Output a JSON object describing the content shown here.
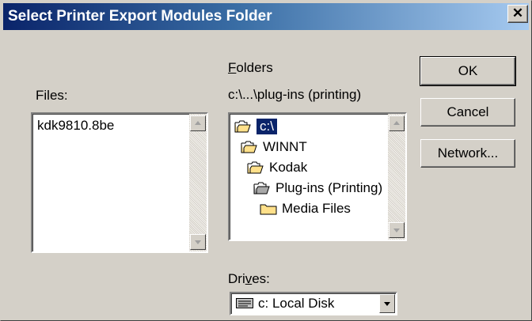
{
  "window": {
    "title": "Select Printer Export Modules Folder",
    "close_glyph": "✕"
  },
  "files": {
    "label": "Files:",
    "items": [
      "kdk9810.8be"
    ]
  },
  "folders": {
    "label_prefix": "",
    "label_accel": "F",
    "label_rest": "olders",
    "current_path": "c:\\...\\plug-ins (printing)",
    "items": [
      {
        "name": "c:\\",
        "selected": true,
        "icon": "open-folder-icon"
      },
      {
        "name": "WINNT",
        "icon": "open-folder-icon"
      },
      {
        "name": "Kodak",
        "icon": "open-folder-icon"
      },
      {
        "name": "Plug-ins (Printing)",
        "icon": "open-folder-icon"
      },
      {
        "name": "Media Files",
        "icon": "closed-folder-icon"
      }
    ]
  },
  "drives": {
    "label_prefix": "Dri",
    "label_accel": "v",
    "label_rest": "es:",
    "selected": "c: Local Disk",
    "icon": "drive-icon"
  },
  "buttons": {
    "ok": "OK",
    "cancel": "Cancel",
    "network": "Network..."
  },
  "colors": {
    "title_start": "#0a246a",
    "title_end": "#a6caf0",
    "face": "#d4d0c8",
    "selection": "#0a246a",
    "folder": "#ffe08a"
  }
}
